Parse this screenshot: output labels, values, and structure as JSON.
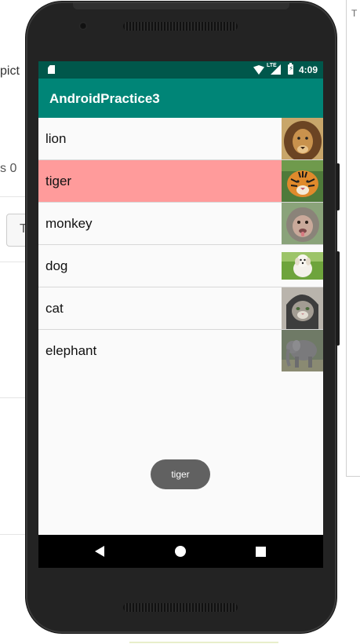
{
  "background_page": {
    "left_text_1": "pict",
    "left_text_2": "s 0",
    "left_button_label": "T",
    "right_panel_text": "T"
  },
  "statusbar": {
    "time": "4:09",
    "network_label": "LTE",
    "icons": [
      "sd-card-icon",
      "wifi-icon",
      "signal-icon",
      "battery-charging-icon"
    ]
  },
  "app": {
    "title": "AndroidPractice3",
    "colors": {
      "primary": "#008577",
      "primary_dark": "#00574b",
      "selected_row": "#ff9b9b"
    }
  },
  "list": {
    "items": [
      {
        "label": "lion",
        "image": "lion-image",
        "selected": false
      },
      {
        "label": "tiger",
        "image": "tiger-image",
        "selected": true
      },
      {
        "label": "monkey",
        "image": "monkey-image",
        "selected": false
      },
      {
        "label": "dog",
        "image": "dog-image",
        "selected": false
      },
      {
        "label": "cat",
        "image": "cat-image",
        "selected": false
      },
      {
        "label": "elephant",
        "image": "elephant-image",
        "selected": false
      }
    ]
  },
  "toast": {
    "text": "tiger"
  },
  "navbar": {
    "icons": [
      "back-icon",
      "home-icon",
      "recents-icon"
    ]
  }
}
